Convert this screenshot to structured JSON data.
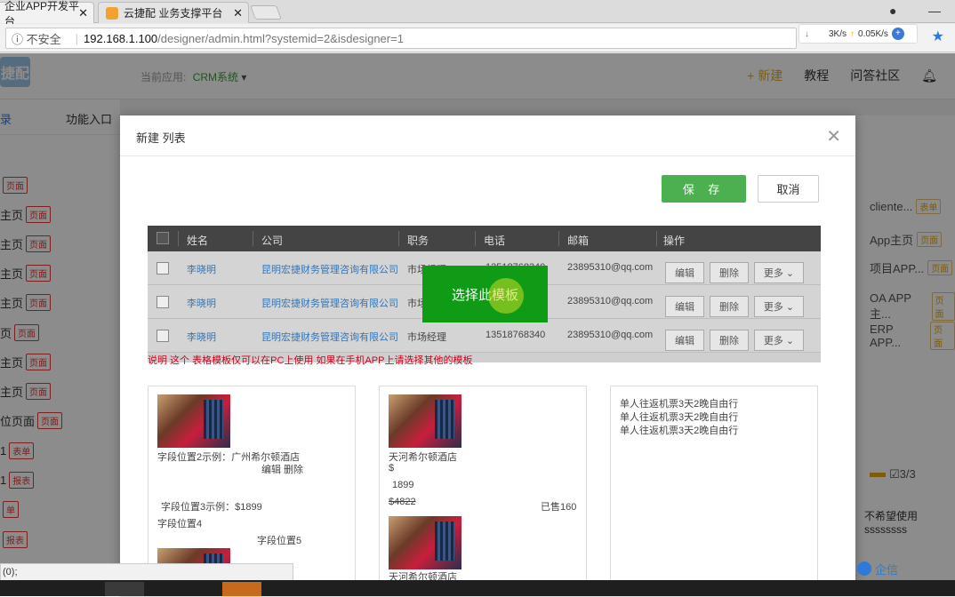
{
  "browser": {
    "tabs": [
      {
        "label": "企业APP开发平台"
      },
      {
        "label": "云捷配 业务支撑平台"
      }
    ],
    "address": {
      "security": "不安全",
      "host": "192.168.1.100",
      "path": "/designer/admin.html?systemid=2&isdesigner=1"
    },
    "net": {
      "down": "3K/s",
      "up": "0.05K/s"
    }
  },
  "app": {
    "logo": "捷配",
    "current_app_label": "当前应用:",
    "current_app": "CRM系统",
    "header": {
      "new": "+ 新建",
      "tutorial": "教程",
      "community": "问答社区"
    },
    "sidebar": {
      "tabs": [
        "录",
        "功能入口"
      ],
      "items": [
        {
          "label": "",
          "badge": "页面"
        },
        {
          "label": "主页",
          "badge": "页面"
        },
        {
          "label": "主页",
          "badge": "页面"
        },
        {
          "label": "主页",
          "badge": "页面"
        },
        {
          "label": "主页",
          "badge": "页面"
        },
        {
          "label": "页",
          "badge": "页面"
        },
        {
          "label": "主页",
          "badge": "页面"
        },
        {
          "label": "主页",
          "badge": "页面"
        },
        {
          "label": "位页面",
          "badge": "页面"
        },
        {
          "label": "1",
          "badge": "表单"
        },
        {
          "label": "1",
          "badge": "报表"
        },
        {
          "label": "",
          "badge": "单"
        },
        {
          "label": "",
          "badge": "报表"
        }
      ]
    },
    "right_panel": {
      "items": [
        {
          "label": "cliente...",
          "tag": "表单"
        },
        {
          "label": "App主页",
          "tag": "页面"
        },
        {
          "label": "项目APP...",
          "tag": "页面"
        },
        {
          "label": "OA APP主...",
          "tag": "页面"
        },
        {
          "label": "ERP APP...",
          "tag": "页面"
        }
      ],
      "check": "☑3/3",
      "note": "不希望使用ssssssss",
      "chat": "企信"
    }
  },
  "modal": {
    "title": "新建 列表",
    "save": "保 存",
    "cancel": "取消",
    "select_template": "选择此模板",
    "table": {
      "headers": [
        "姓名",
        "公司",
        "职务",
        "电话",
        "邮箱",
        "操作"
      ],
      "rows": [
        {
          "name": "李晓明",
          "company": "昆明宏捷财务管理咨询有限公司",
          "title": "市场经理",
          "phone": "13518768340",
          "email": "23895310@qq.com"
        },
        {
          "name": "李晓明",
          "company": "昆明宏捷财务管理咨询有限公司",
          "title": "市场经理",
          "phone": "13518768340",
          "email": "23895310@qq.com"
        },
        {
          "name": "李晓明",
          "company": "昆明宏捷财务管理咨询有限公司",
          "title": "市场经理",
          "phone": "13518768340",
          "email": "23895310@qq.com"
        }
      ],
      "ops": [
        "编辑",
        "删除",
        "更多 ⌄"
      ],
      "note": "说明 这个 表格模板仅可以在PC上使用 如果在手机APP上请选择其他的模板"
    },
    "cards": {
      "card1": {
        "field2": "字段位置2示例：广州希尔顿酒店",
        "actions": "编辑 删除",
        "field3": "字段位置3示例：$1899",
        "field4": "字段位置4",
        "field5": "字段位置5"
      },
      "card2": {
        "name": "天河希尔顿酒店",
        "currency": "$",
        "price": "1899",
        "old_price": "$4822",
        "sold": "已售160",
        "name2": "天河希尔顿酒店"
      },
      "card3": {
        "lines": [
          "单人往返机票3天2晚自由行",
          "单人往返机票3天2晚自由行",
          "单人往返机票3天2晚自由行"
        ]
      }
    }
  },
  "status": "(0);"
}
